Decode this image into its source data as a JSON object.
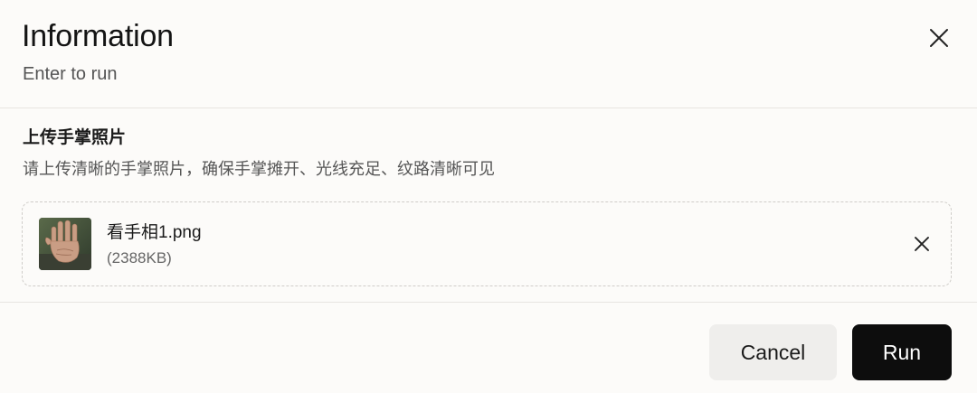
{
  "dialog": {
    "title": "Information",
    "subtitle": "Enter to run",
    "close_icon": "close-icon"
  },
  "field": {
    "label": "上传手掌照片",
    "hint": "请上传清晰的手掌照片，确保手掌摊开、光线充足、纹路清晰可见"
  },
  "file": {
    "name": "看手相1.png",
    "size": "(2388KB)",
    "thumbnail_icon": "palm-photo-thumbnail",
    "remove_icon": "close-icon"
  },
  "actions": {
    "cancel_label": "Cancel",
    "run_label": "Run"
  },
  "colors": {
    "background": "#fcfbf9",
    "run_button": "#0d0d0d",
    "cancel_button": "#efeeec",
    "divider": "#e7e5e1"
  }
}
